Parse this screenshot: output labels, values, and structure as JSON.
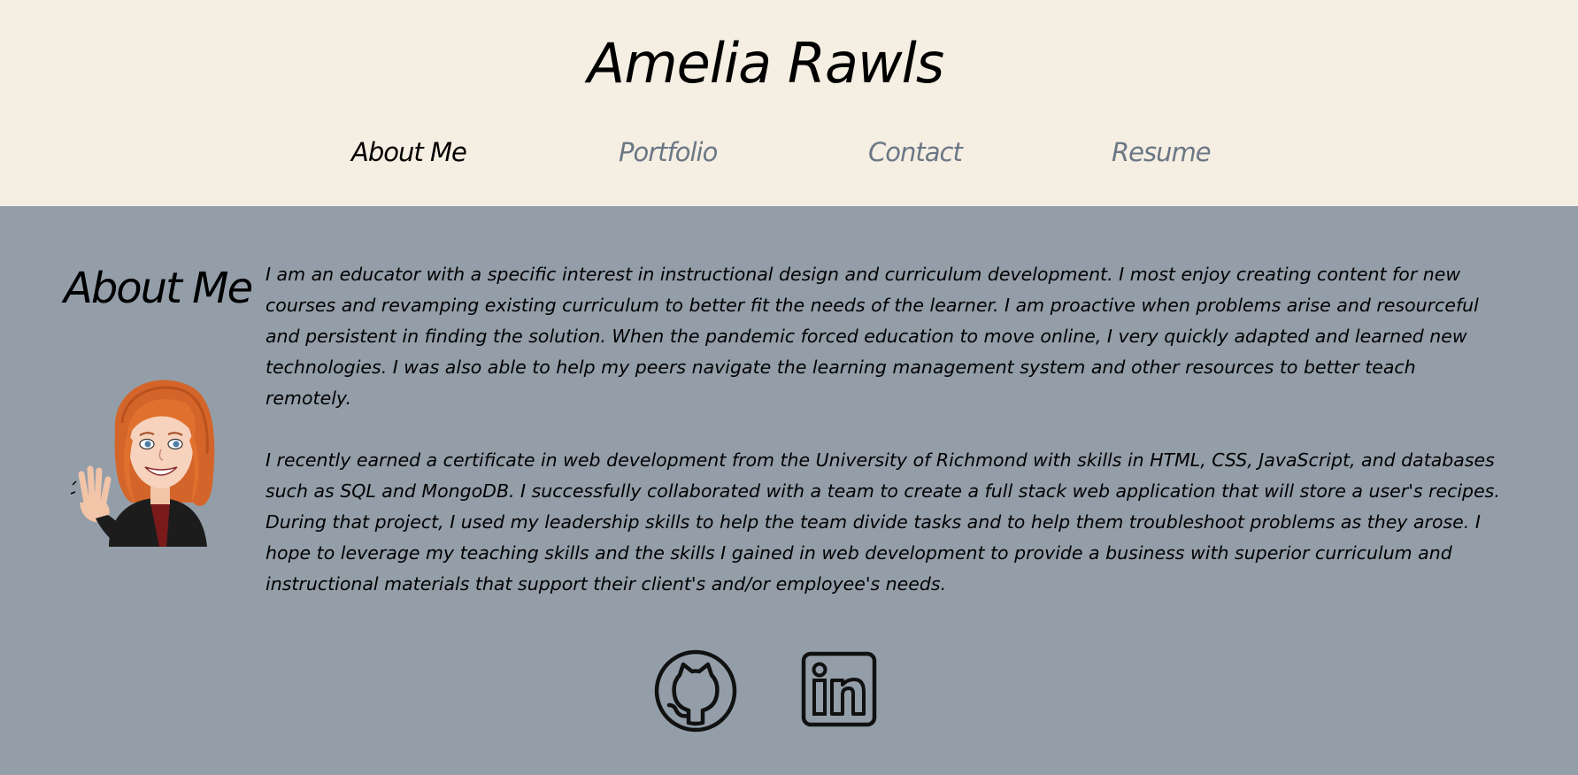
{
  "header": {
    "site_title": "Amelia Rawls",
    "nav": [
      {
        "label": "About Me",
        "active": true
      },
      {
        "label": "Portfolio",
        "active": false
      },
      {
        "label": "Contact",
        "active": false
      },
      {
        "label": "Resume",
        "active": false
      }
    ]
  },
  "about": {
    "heading": "About Me",
    "avatar_icon": "bitmoji-avatar-waving",
    "paragraphs": [
      "I am an educator with a specific interest in instructional design and curriculum development. I most enjoy creating content for new courses and revamping existing curriculum to better fit the needs of the learner. I am proactive when problems arise and resourceful and persistent in finding the solution. When the pandemic forced education to move online, I very quickly adapted and learned new technologies. I was also able to help my peers navigate the learning management system and other resources to better teach remotely.",
      "I recently earned a certificate in web development from the University of Richmond with skills in HTML, CSS, JavaScript, and databases such as SQL and MongoDB. I successfully collaborated with a team to create a full stack web application that will store a user's recipes. During that project, I used my leadership skills to help the team divide tasks and to help them troubleshoot problems as they arose. I hope to leverage my teaching skills and the skills I gained in web development to provide a business with superior curriculum and instructional materials that support their client's and/or employee's needs."
    ]
  },
  "social": {
    "github_icon": "github-icon",
    "linkedin_icon": "linkedin-icon"
  },
  "colors": {
    "header_bg": "#f5eee2",
    "main_bg": "#939ea9",
    "nav_active": "#000000",
    "nav_inactive": "#6b7785"
  }
}
